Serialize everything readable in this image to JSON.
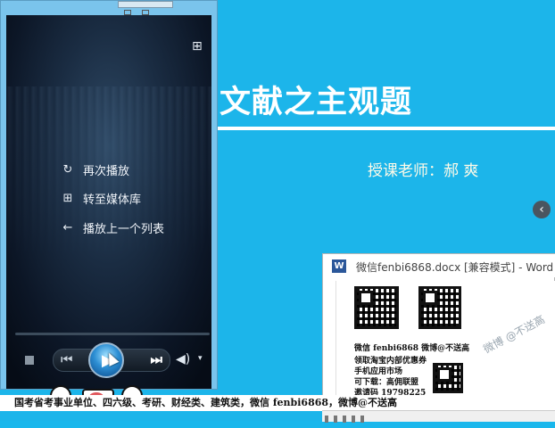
{
  "slide": {
    "title": "文献之主观题",
    "teacher": "授课老师：郝 爽",
    "nav_arrow": "‹"
  },
  "player": {
    "menu": [
      {
        "icon": "↻",
        "label": "再次播放"
      },
      {
        "icon": "⊞",
        "label": "转至媒体库"
      },
      {
        "icon": "←",
        "label": "播放上一个列表"
      }
    ],
    "prev_symbol": "⏮",
    "next_symbol": "⏭",
    "play_symbol": "▶",
    "volume_symbol": "🔊",
    "dropdown_symbol": "▾"
  },
  "word_window": {
    "logo": "W",
    "title": "微信fenbi6868.docx [兼容模式] - Word (",
    "doc_lines": [
      "微信 fenbi6868 微博@不送高",
      "领取淘宝内部优惠券",
      "手机应用市场",
      "可下载：高佣联盟",
      "邀请码 19798225"
    ],
    "watermark": "微博 @不送高"
  },
  "bottom_note": "国考省考事业单位、四六级、考研、财经类、建筑类，微信 fenbi6868，微博@不送高",
  "colors": {
    "slide_bg": "#1cb5ea",
    "word_brand": "#2b579a"
  }
}
